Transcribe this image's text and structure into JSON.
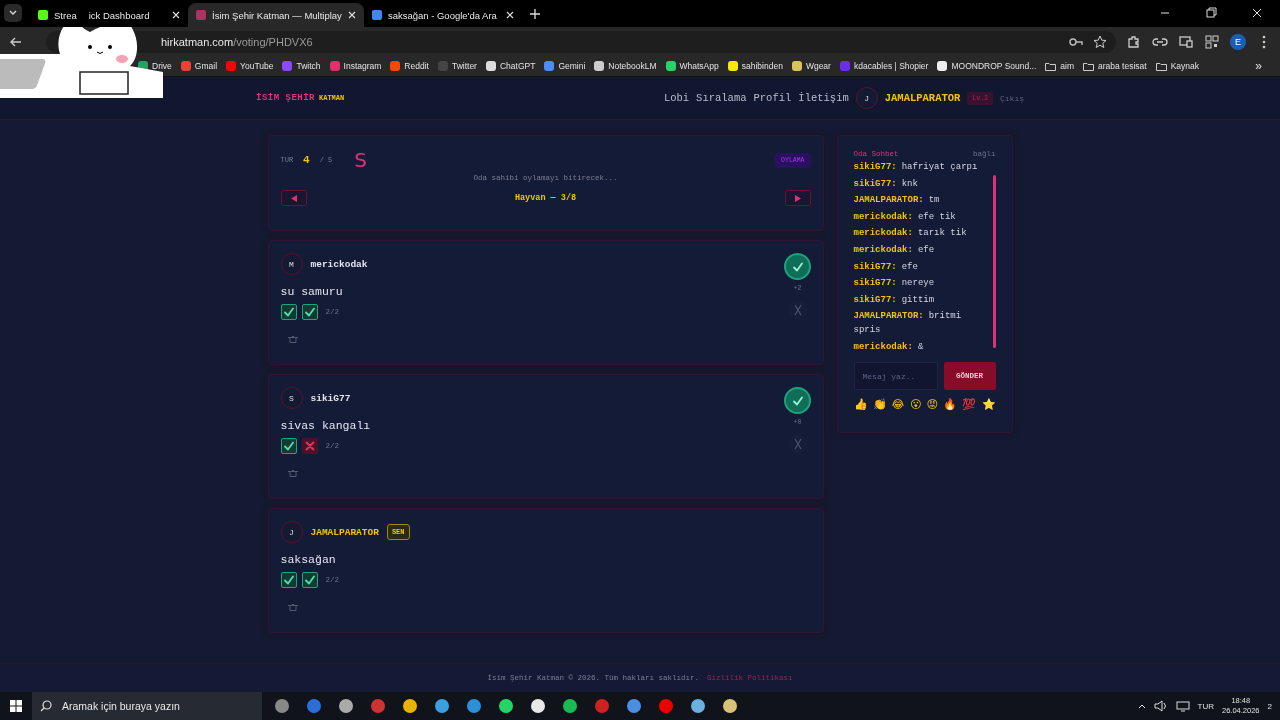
{
  "browser": {
    "tabs": [
      {
        "title_parts": [
          "Strea",
          "ick Dashboard"
        ],
        "selected": false
      },
      {
        "title_parts": [
          "İsim Şehir Katman — Multiplay"
        ],
        "selected": true
      },
      {
        "title_parts": [
          "saksağan - Google'da Ara"
        ],
        "selected": false
      }
    ],
    "address": {
      "host": "hirkatman.com",
      "path": "/voting/PHDVX6"
    },
    "profile_initial": "E",
    "bookmarks": [
      {
        "kind": "site",
        "label": "Drive",
        "color": "#1fa463"
      },
      {
        "kind": "site",
        "label": "Gmail",
        "color": "#ea4335"
      },
      {
        "kind": "site",
        "label": "YouTube",
        "color": "#ff0000"
      },
      {
        "kind": "site",
        "label": "Twitch",
        "color": "#9146ff"
      },
      {
        "kind": "site",
        "label": "Instagram",
        "color": "#e1306c"
      },
      {
        "kind": "site",
        "label": "Reddit",
        "color": "#ff4500"
      },
      {
        "kind": "site",
        "label": "Twitter",
        "color": "#444444"
      },
      {
        "kind": "site",
        "label": "ChatGPT",
        "color": "#dddddd"
      },
      {
        "kind": "site",
        "label": "Gemini",
        "color": "#4e8cf7"
      },
      {
        "kind": "site",
        "label": "NotebookLM",
        "color": "#cccccc"
      },
      {
        "kind": "site",
        "label": "WhatsApp",
        "color": "#25d366"
      },
      {
        "kind": "site",
        "label": "sahibinden",
        "color": "#ffe800"
      },
      {
        "kind": "site",
        "label": "Wgear",
        "color": "#d9c25a"
      },
      {
        "kind": "site",
        "label": "kdacables | Shopier",
        "color": "#6a2cf0"
      },
      {
        "kind": "site",
        "label": "MOONDROP Sound...",
        "color": "#eeeeee"
      },
      {
        "kind": "folder",
        "label": "aim"
      },
      {
        "kind": "folder",
        "label": "araba tesisat"
      },
      {
        "kind": "folder",
        "label": "Kaynak"
      }
    ],
    "more": "»"
  },
  "header": {
    "logo_main": "İSİM ŞEHİR",
    "logo_accent": "KATMAN",
    "nav": [
      "Lobi",
      "Sıralama",
      "Profil",
      "İletişim"
    ],
    "user": {
      "initial": "J",
      "name": "JAMALPARATOR",
      "level": "Lv.3"
    },
    "logout": "Çıkış"
  },
  "round": {
    "label": "TUR",
    "current": "4",
    "total": "/ 5",
    "letter": "S",
    "phase": "OYLAMA",
    "status": "Oda sahibi oylamayı bitirecek...",
    "category": "Hayvan — 3/8"
  },
  "answers": [
    {
      "initial": "M",
      "name": "merickodak",
      "is_you": false,
      "answer": "su samuru",
      "votes": [
        {
          "kind": "approve"
        },
        {
          "kind": "approve"
        }
      ],
      "vote_count": "2/2",
      "vote_panel": {
        "approved": true,
        "score": "+2"
      }
    },
    {
      "initial": "S",
      "name": "sikiG77",
      "is_you": false,
      "answer": "sivas kangalı",
      "votes": [
        {
          "kind": "approve"
        },
        {
          "kind": "reject"
        }
      ],
      "vote_count": "2/2",
      "vote_panel": {
        "approved": true,
        "score": "+0"
      }
    },
    {
      "initial": "J",
      "name": "JAMALPARATOR",
      "is_you": true,
      "badge": "SEN",
      "answer": "saksağan",
      "votes": [
        {
          "kind": "approve"
        },
        {
          "kind": "approve"
        }
      ],
      "vote_count": "2/2"
    }
  ],
  "chat": {
    "title": "Oda Sohbet",
    "status": "bağlı",
    "messages": [
      {
        "user": "sikiG77:",
        "text": "hafriyat çarpı"
      },
      {
        "user": "sikiG77:",
        "text": "knk"
      },
      {
        "user": "JAMALPARATOR:",
        "text": "tm"
      },
      {
        "user": "merickodak:",
        "text": "efe tik"
      },
      {
        "user": "merickodak:",
        "text": "tarık tik"
      },
      {
        "user": "merickodak:",
        "text": "efe"
      },
      {
        "user": "sikiG77:",
        "text": "efe"
      },
      {
        "user": "sikiG77:",
        "text": "nereye"
      },
      {
        "user": "sikiG77:",
        "text": "gittim"
      },
      {
        "user": "JAMALPARATOR:",
        "text": "britmi spris"
      },
      {
        "user": "merickodak:",
        "text": "&"
      }
    ],
    "placeholder": "Mesaj yaz..",
    "send": "GÖNDER",
    "reactions": [
      "👍",
      "👏",
      "😂",
      "😮",
      "😡",
      "🔥",
      "💯",
      "⭐"
    ]
  },
  "footer": {
    "text": "İsim Şehir Katman © 2026. Tüm hakları saklıdır.",
    "link": "Gizlilik Politikası"
  },
  "taskbar": {
    "search_placeholder": "Aramak için buraya yazın",
    "language": "TUR",
    "time": "18:48",
    "date": "26.04.2026",
    "notifications": "2"
  }
}
